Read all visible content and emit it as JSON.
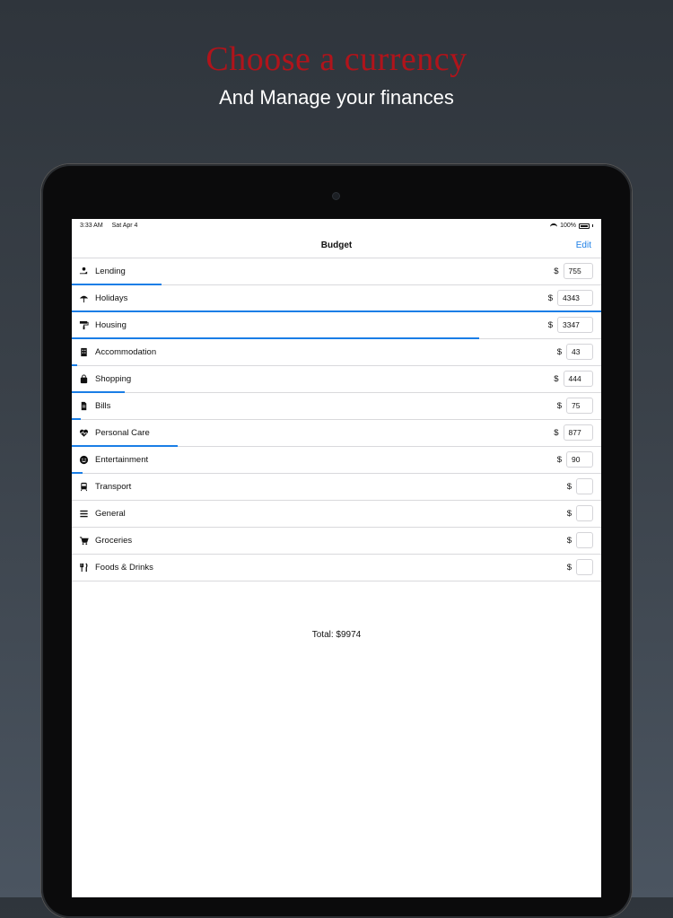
{
  "hero": {
    "title": "Choose a currency",
    "subtitle": "And Manage your finances",
    "title_color": "#b0141b"
  },
  "status_bar": {
    "time": "3:33 AM",
    "date": "Sat Apr 4",
    "battery": "100%"
  },
  "nav": {
    "title": "Budget",
    "edit_label": "Edit",
    "accent_color": "#1a7ee6"
  },
  "categories": [
    {
      "label": "Lending",
      "icon": "hand-coin-icon",
      "currency": "$",
      "value": "755",
      "progress": 0.17
    },
    {
      "label": "Holidays",
      "icon": "beach-umbrella-icon",
      "currency": "$",
      "value": "4343",
      "progress": 1.0
    },
    {
      "label": "Housing",
      "icon": "paint-roller-icon",
      "currency": "$",
      "value": "3347",
      "progress": 0.77
    },
    {
      "label": "Accommodation",
      "icon": "building-icon",
      "currency": "$",
      "value": "43",
      "progress": 0.01
    },
    {
      "label": "Shopping",
      "icon": "shopping-bag-icon",
      "currency": "$",
      "value": "444",
      "progress": 0.1
    },
    {
      "label": "Bills",
      "icon": "document-icon",
      "currency": "$",
      "value": "75",
      "progress": 0.017
    },
    {
      "label": "Personal Care",
      "icon": "heartbeat-icon",
      "currency": "$",
      "value": "877",
      "progress": 0.2
    },
    {
      "label": "Entertainment",
      "icon": "smile-icon",
      "currency": "$",
      "value": "90",
      "progress": 0.02
    },
    {
      "label": "Transport",
      "icon": "train-icon",
      "currency": "$",
      "value": "",
      "progress": 0
    },
    {
      "label": "General",
      "icon": "list-icon",
      "currency": "$",
      "value": "",
      "progress": 0
    },
    {
      "label": "Groceries",
      "icon": "cart-icon",
      "currency": "$",
      "value": "",
      "progress": 0
    },
    {
      "label": "Foods & Drinks",
      "icon": "utensils-icon",
      "currency": "$",
      "value": "",
      "progress": 0
    }
  ],
  "total_label": "Total: $9974"
}
